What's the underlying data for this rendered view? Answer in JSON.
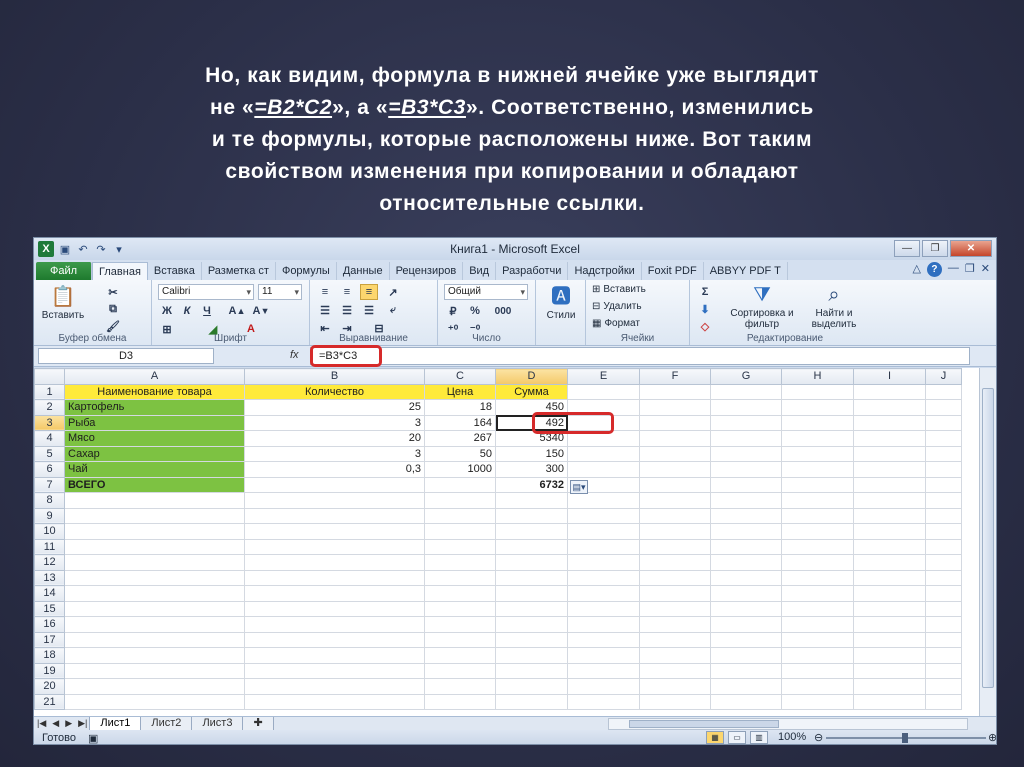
{
  "caption": {
    "line1": "Но, как видим, формула в нижней ячейке уже выглядит",
    "line2_pre": "не «",
    "line2_f1": "=B2*C2",
    "line2_mid": "», а «",
    "line2_f2": "=B3*C3",
    "line2_post": "». Соответственно, изменились",
    "line3": "и те формулы, которые расположены ниже. Вот таким",
    "line4": "свойством изменения при копировании и обладают",
    "line5": "относительные ссылки."
  },
  "window": {
    "title": "Книга1 - Microsoft Excel",
    "logo": "X",
    "min": "—",
    "restore": "❐",
    "close": "✕"
  },
  "tabs": [
    "Файл",
    "Главная",
    "Вставка",
    "Разметка ст",
    "Формулы",
    "Данные",
    "Рецензиров",
    "Вид",
    "Разработчи",
    "Надстройки",
    "Foxit PDF",
    "ABBYY PDF T"
  ],
  "ribbon": {
    "paste": "Вставить",
    "clipboard": "Буфер обмена",
    "font_name": "Calibri",
    "font_size": "11",
    "bold": "Ж",
    "italic": "К",
    "underline": "Ч",
    "font_group": "Шрифт",
    "align_group": "Выравнивание",
    "number_format": "Общий",
    "percent": "%",
    "thousands": "000",
    "number_group": "Число",
    "styles": "Стили",
    "insert": "Вставить",
    "delete": "Удалить",
    "format": "Формат",
    "cells_group": "Ячейки",
    "sort": "Сортировка и фильтр",
    "find": "Найти и выделить",
    "editing_group": "Редактирование"
  },
  "formula_bar": {
    "name_box": "D3",
    "fx": "fx",
    "formula": "=B3*C3"
  },
  "grid": {
    "columns": [
      "A",
      "B",
      "C",
      "D",
      "E",
      "F",
      "G",
      "H",
      "I",
      "J"
    ],
    "rows": [
      {
        "n": "1",
        "a": "Наименование товара",
        "b": "Количество",
        "c": "Цена",
        "d": "Сумма"
      },
      {
        "n": "2",
        "a": "Картофель",
        "b": "25",
        "c": "18",
        "d": "450"
      },
      {
        "n": "3",
        "a": "Рыба",
        "b": "3",
        "c": "164",
        "d": "492"
      },
      {
        "n": "4",
        "a": "Мясо",
        "b": "20",
        "c": "267",
        "d": "5340"
      },
      {
        "n": "5",
        "a": "Сахар",
        "b": "3",
        "c": "50",
        "d": "150"
      },
      {
        "n": "6",
        "a": "Чай",
        "b": "0,3",
        "c": "1000",
        "d": "300"
      },
      {
        "n": "7",
        "a": "ВСЕГО",
        "b": "",
        "c": "",
        "d": "6732"
      },
      {
        "n": "8"
      },
      {
        "n": "9"
      },
      {
        "n": "10"
      },
      {
        "n": "11"
      },
      {
        "n": "12"
      },
      {
        "n": "13"
      },
      {
        "n": "14"
      },
      {
        "n": "15"
      },
      {
        "n": "16"
      },
      {
        "n": "17"
      },
      {
        "n": "18"
      },
      {
        "n": "19"
      },
      {
        "n": "20"
      },
      {
        "n": "21"
      }
    ],
    "header_color": "#ffea3a",
    "name_color": "#7dc242"
  },
  "sheet_tabs": [
    "Лист1",
    "Лист2",
    "Лист3"
  ],
  "status": {
    "ready": "Готово",
    "zoom": "100%"
  }
}
